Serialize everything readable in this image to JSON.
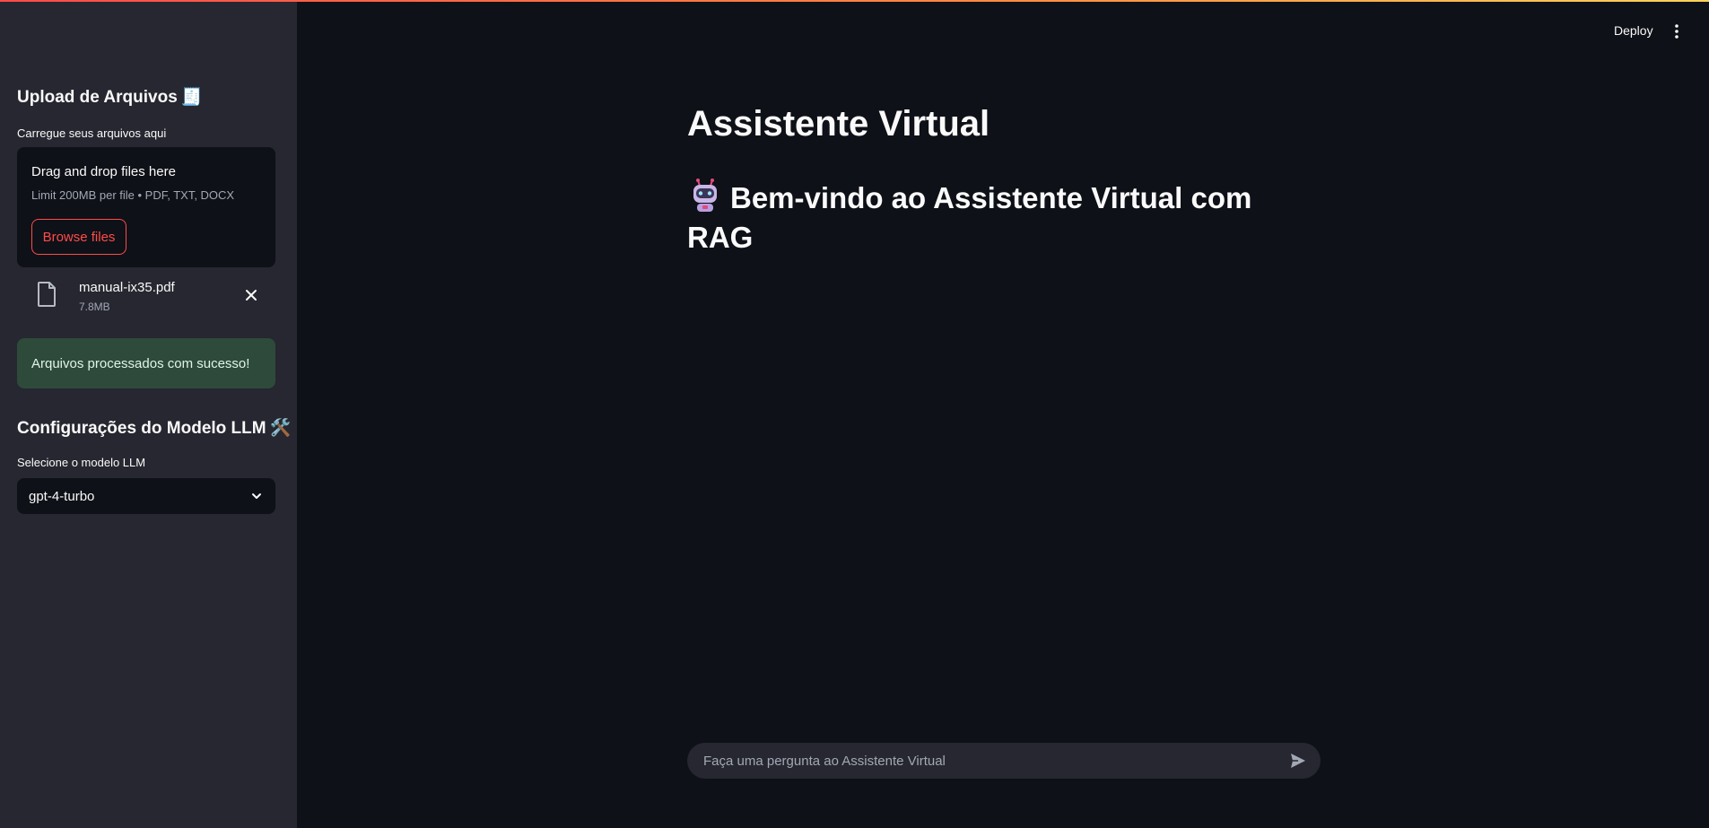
{
  "topbar": {
    "deploy_label": "Deploy",
    "menu_icon": "kebab-menu-icon"
  },
  "sidebar": {
    "upload_heading": "Upload de Arquivos",
    "upload_heading_emoji": "🧾",
    "uploader_label": "Carregue seus arquivos aqui",
    "dropzone": {
      "title": "Drag and drop files here",
      "subtitle": "Limit 200MB per file • PDF, TXT, DOCX",
      "browse_label": "Browse files"
    },
    "uploaded_file": {
      "name": "manual-ix35.pdf",
      "size": "7.8MB",
      "icon": "file-icon"
    },
    "success_message": "Arquivos processados com sucesso!",
    "config_heading": "Configurações do Modelo LLM",
    "config_heading_emoji": "🛠️",
    "select_label": "Selecione o modelo LLM",
    "selected_model": "gpt-4-turbo"
  },
  "main": {
    "title": "Assistente Virtual",
    "welcome": "Bem-vindo ao Assistente Virtual com RAG",
    "welcome_icon": "robot-icon"
  },
  "chat": {
    "placeholder": "Faça uma pergunta ao Assistente Virtual",
    "send_icon": "send-icon"
  },
  "colors": {
    "accent": "#ff4b4b",
    "sidebar_bg": "#262730",
    "main_bg": "#0e1117",
    "success_bg": "#2e4a3b"
  }
}
